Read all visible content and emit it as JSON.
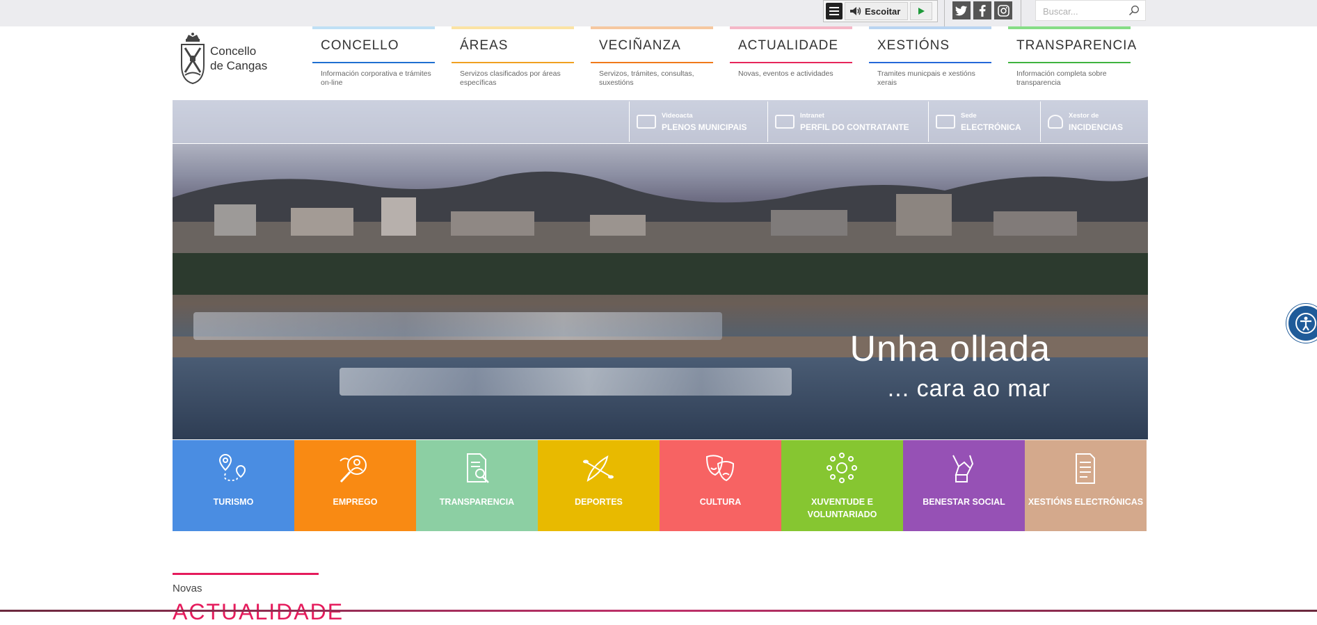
{
  "toolbar": {
    "listen_label": "Escoitar",
    "search_placeholder": "Buscar...",
    "social": [
      "twitter-icon",
      "facebook-icon",
      "instagram-icon"
    ]
  },
  "logo": {
    "line1": "Concello",
    "line2": "de Cangas"
  },
  "nav": [
    {
      "title": "CONCELLO",
      "desc": "Información corporativa e trámites on-line",
      "color": "#1f6fd1",
      "bar": "#bfe0f5"
    },
    {
      "title": "ÁREAS",
      "desc": "Servizos clasificados por áreas específicas",
      "color": "#f0a020",
      "bar": "#fbe3a4"
    },
    {
      "title": "VECIÑANZA",
      "desc": "Servizos, trámites, consultas, suxestións",
      "color": "#f07a1a",
      "bar": "#f6c8a0"
    },
    {
      "title": "ACTUALIDADE",
      "desc": "Novas, eventos e actividades",
      "color": "#e6255a",
      "bar": "#f5b8c8"
    },
    {
      "title": "XESTIÓNS",
      "desc": "Tramites municpais e xestións xerais",
      "color": "#2468d8",
      "bar": "#b9d4f1"
    },
    {
      "title": "TRANSPARENCIA",
      "desc": "Información completa sobre transparencia",
      "color": "#3fb33f",
      "bar": "#86dd86"
    }
  ],
  "quick_links": [
    {
      "small": "Videoacta",
      "big": "PLENOS MUNICIPAIS"
    },
    {
      "small": "Intranet",
      "big": "PERFIL DO CONTRATANTE"
    },
    {
      "small": "Sede",
      "big": "ELECTRÓNICA"
    },
    {
      "small": "Xestor de",
      "big": "INCIDENCIAS"
    }
  ],
  "hero": {
    "headline": "Unha ollada",
    "subheadline": "... cara ao mar"
  },
  "tiles": [
    {
      "label": "TURISMO",
      "color": "#4a8de2",
      "icon": "map-pin-icon"
    },
    {
      "label": "EMPREGO",
      "color": "#f98a13",
      "icon": "job-search-icon"
    },
    {
      "label": "TRANSPARENCIA",
      "color": "#8ccfa3",
      "icon": "document-search-icon"
    },
    {
      "label": "DEPORTES",
      "color": "#e8ba00",
      "icon": "kayak-icon"
    },
    {
      "label": "CULTURA",
      "color": "#f76363",
      "icon": "theater-masks-icon"
    },
    {
      "label": "XUVENTUDE E VOLUNTARIADO",
      "color": "#86c631",
      "icon": "community-network-icon"
    },
    {
      "label": "BENESTAR SOCIAL",
      "color": "#9651b5",
      "icon": "helping-hands-icon"
    },
    {
      "label": "XESTIÓNS ELECTRÓNICAS",
      "color": "#d4a98c",
      "icon": "e-form-icon"
    }
  ],
  "news": {
    "small": "Novas",
    "big": "ACTUALIDADE"
  }
}
